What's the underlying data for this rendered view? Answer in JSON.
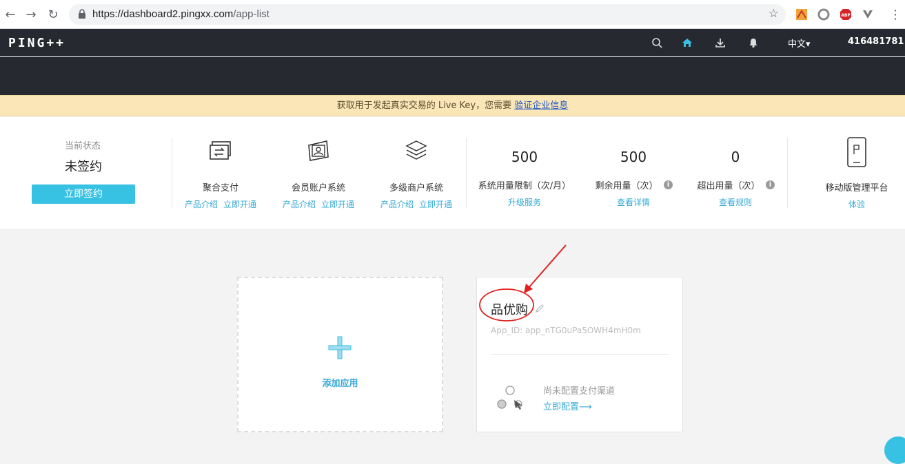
{
  "browser": {
    "url_host": "https://dashboard2.pingxx.com",
    "url_path": "/app-list",
    "extensions": [
      "wayback-icon",
      "circle-extension-icon",
      "adblock-icon",
      "v-extension-icon"
    ]
  },
  "header": {
    "logo": "PING++",
    "language": "中文▾",
    "user_id": "416481781"
  },
  "notice": {
    "text": "获取用于发起真实交易的 Live Key，您需要",
    "link": "验证企业信息"
  },
  "status": {
    "label": "当前状态",
    "value": "未签约",
    "sign_button": "立即签约"
  },
  "products": [
    {
      "icon": "aggregate-pay-icon",
      "name": "聚合支付",
      "link1": "产品介绍",
      "link2": "立即开通"
    },
    {
      "icon": "member-account-icon",
      "name": "会员账户系统",
      "link1": "产品介绍",
      "link2": "立即开通"
    },
    {
      "icon": "multi-merchant-icon",
      "name": "多级商户系统",
      "link1": "产品介绍",
      "link2": "立即开通"
    }
  ],
  "metrics": [
    {
      "value": "500",
      "label": "系统用量限制（次/月）",
      "link": "升级服务"
    },
    {
      "value": "500",
      "label": "剩余用量（次）",
      "link": "查看详情"
    },
    {
      "value": "0",
      "label": "超出用量（次）",
      "link": "查看规则"
    }
  ],
  "mobile": {
    "name": "移动版管理平台",
    "link": "体验"
  },
  "add_card": {
    "label": "添加应用"
  },
  "app_card": {
    "name": "品优购",
    "app_id": "App_ID: app_nTG0uPa5OWH4mH0m",
    "pay_status": "尚未配置支付渠道",
    "pay_link": "立即配置⟶"
  },
  "colors": {
    "accent": "#37c1e3",
    "link": "#37a9d6",
    "header_bg": "#262a30",
    "notice_bg": "#fbe6b8",
    "annotation": "#e0201e"
  }
}
